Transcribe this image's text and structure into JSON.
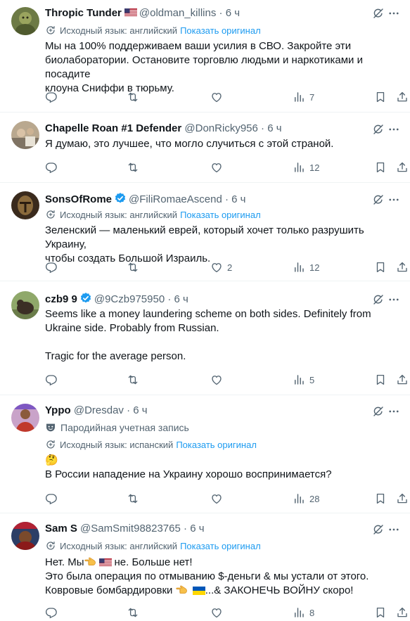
{
  "common": {
    "translated_label": "Исходный язык: английский",
    "show_original": "Показать оригинал",
    "dot": "·"
  },
  "posts": [
    {
      "name": "Thropic Tunder",
      "handle": "@oldman_killins",
      "time": "6 ч",
      "translation_note": "Исходный язык: английский",
      "lines": [
        "Мы на 100% поддерживаем ваши усилия в СВО. Закройте эти",
        "биолаборатории. Остановите торговлю людьми и наркотиками и посадите",
        "клоуна Сниффи в тюрьму."
      ],
      "views": "7",
      "flag": "us"
    },
    {
      "name": "Chapelle Roan #1 Defender",
      "handle": "@DonRicky956",
      "time": "6 ч",
      "lines": [
        "Я думаю, это лучшее, что могло случиться с этой страной."
      ],
      "views": "12"
    },
    {
      "name": "SonsOfRome",
      "handle": "@FiliRomaeAscend",
      "time": "6 ч",
      "translation_note": "Исходный язык: английский",
      "lines": [
        "Зеленский — маленький еврей, который хочет только разрушить Украину,",
        "чтобы создать Большой Израиль."
      ],
      "likes": "2",
      "views": "12",
      "verified": true
    },
    {
      "name": "czb9 9",
      "handle": "@9Czb975950",
      "time": "6 ч",
      "lines": [
        "Seems like a money laundering scheme on both sides. Definitely from",
        "Ukraine side. Probably from Russian.",
        "",
        "Tragic for the average person."
      ],
      "views": "5",
      "verified": true
    },
    {
      "name": "Yppo",
      "handle": "@Dresdav",
      "time": "6 ч",
      "parody_label": "Пародийная учетная запись",
      "translation_note": "Исходный язык: испанский",
      "lines": [
        "🤔",
        "В России нападение на Украину хорошо воспринимается?"
      ],
      "views": "28"
    },
    {
      "name": "Sam S",
      "handle": "@SamSmit98823765",
      "time": "6 ч",
      "translation_note": "Исходный язык: английский",
      "line1_a": "Нет. Мы",
      "line1_b": "не. Больше нет!",
      "line2": "Это была операция по отмыванию $-деньги & мы устали от этого.",
      "line3_a": "Ковровые бомбардировки",
      "line3_b": "...& ЗАКОНЕЧЬ ВОЙНУ скоро!",
      "views": "8"
    }
  ],
  "icons": {
    "reply": "reply-icon",
    "repost": "repost-icon",
    "like": "like-icon",
    "views": "views-icon",
    "bookmark": "bookmark-icon",
    "share": "share-icon",
    "grok": "grok-icon",
    "more": "more-icon",
    "translate": "translate-icon"
  },
  "colors": {
    "text": "#0f1419",
    "muted": "#536471",
    "link": "#1d9bf0",
    "verified": "#1d9bf0",
    "divider": "#eff3f4"
  }
}
